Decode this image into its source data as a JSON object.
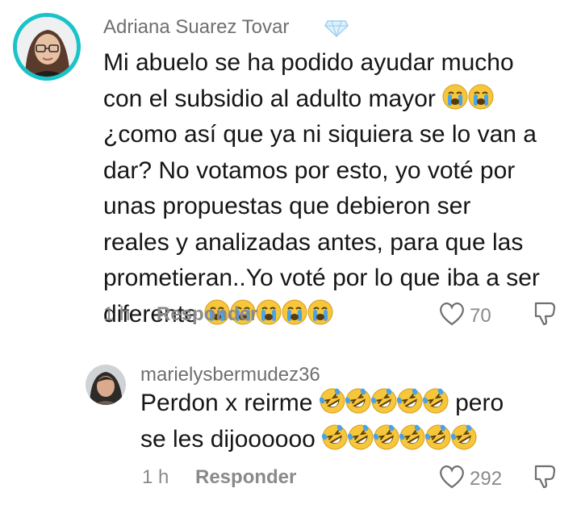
{
  "comments": [
    {
      "username": "Adriana Suarez Tovar",
      "badge_icon": "diamond-icon",
      "lines": [
        "Mi abuelo se ha podido ayudar mucho",
        "con el subsidio al adulto mayor",
        "¿como así que ya ni siquiera se lo van a",
        "dar? No votamos por esto, yo voté por",
        "unas propuestas que debieron ser",
        "reales y analizadas antes, para que las",
        "prometieran..Yo voté por lo que iba a ser",
        "diferente"
      ],
      "emoji_name": "loudly-crying-face",
      "time": "1 h",
      "reply_label": "Responder",
      "likes": "70"
    },
    {
      "username": "marielysbermudez36",
      "lines": [
        "Perdon x reirme",
        "pero",
        "se les dijoooooo"
      ],
      "emoji_name": "rolling-on-floor-laughing",
      "time": "1 h",
      "reply_label": "Responder",
      "likes": "292"
    }
  ],
  "colors": {
    "avatar_ring": "#18c4c9",
    "meta_text": "#8a8a8a",
    "emoji_face": "#f6c73a"
  }
}
